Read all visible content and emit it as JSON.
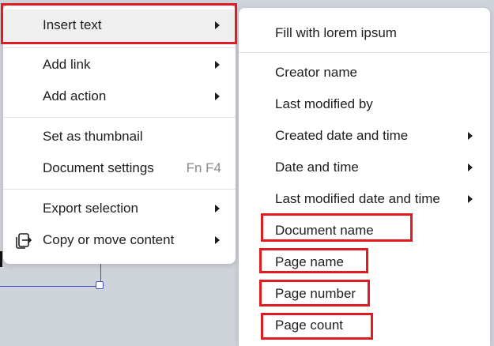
{
  "main_menu": {
    "insert_text": "Insert text",
    "add_link": "Add link",
    "add_action": "Add action",
    "set_thumbnail": "Set as thumbnail",
    "document_settings": "Document settings",
    "document_settings_shortcut": "Fn F4",
    "export_selection": "Export selection",
    "copy_or_move": "Copy or move content"
  },
  "submenu": {
    "fill_lorem": "Fill with lorem ipsum",
    "creator_name": "Creator name",
    "last_modified_by": "Last modified by",
    "created_date_time": "Created date and time",
    "date_time": "Date and time",
    "last_modified_date_time": "Last modified date and time",
    "document_name": "Document name",
    "page_name": "Page name",
    "page_number": "Page number",
    "page_count": "Page count"
  },
  "icons": {
    "submenu_arrow": "chevron-right-icon",
    "copy_move": "copy-move-icon"
  },
  "colors": {
    "highlight": "#e01b22",
    "selection": "#3f4bd6",
    "backdrop": "#cfd3da"
  }
}
